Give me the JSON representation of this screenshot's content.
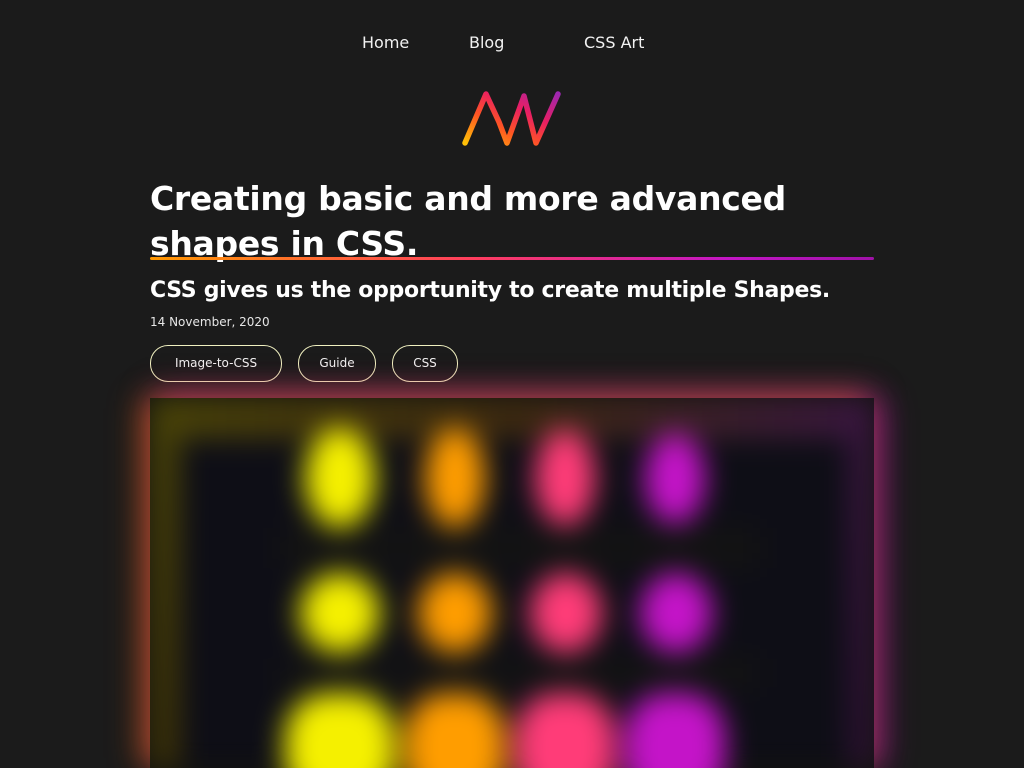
{
  "nav": {
    "items": [
      "Home",
      "Blog",
      "CSS Art"
    ]
  },
  "logo": {
    "icon": "aw-logo-icon",
    "gradient": [
      "#ffc107",
      "#ff5722",
      "#e91e63",
      "#9c27b0"
    ]
  },
  "article": {
    "title": "Creating basic and more advanced shapes in CSS.",
    "subtitle": "CSS gives us the opportunity to create multiple Shapes.",
    "date": "14 November, 2020",
    "tags": [
      "Image-to-CSS",
      "Guide",
      "CSS"
    ]
  },
  "hero": {
    "colors": [
      "#f5f000",
      "#ff9d00",
      "#ff3c78",
      "#c414c8"
    ]
  },
  "theme": {
    "background": "#1b1b1b",
    "text": "#ffffff",
    "accent_gradient": [
      "#ff9800",
      "#ff3d5f",
      "#c316c6"
    ]
  }
}
